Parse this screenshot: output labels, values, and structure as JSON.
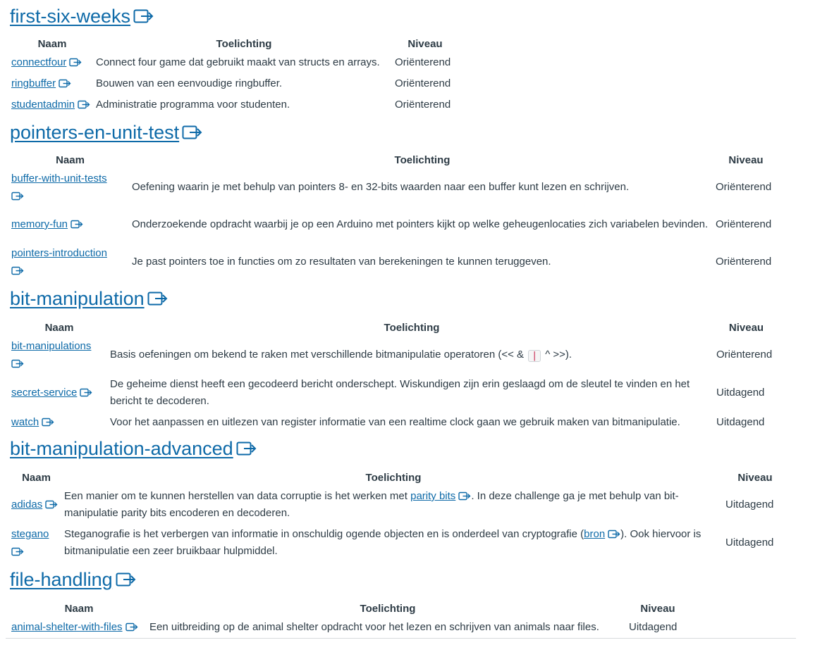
{
  "icons": {
    "external_link": "external-link-icon"
  },
  "colors": {
    "link": "#0e6aa8",
    "text": "#2d3b45",
    "code": "#c7254e"
  },
  "sections": [
    {
      "title": "first-six-weeks",
      "headers": {
        "name": "Naam",
        "desc": "Toelichting",
        "level": "Niveau"
      },
      "rows": [
        {
          "name": "connectfour",
          "desc": "Connect four game dat gebruikt maakt van structs en arrays.",
          "level": "Oriënterend"
        },
        {
          "name": "ringbuffer",
          "desc": "Bouwen van een eenvoudige ringbuffer.",
          "level": "Oriënterend"
        },
        {
          "name": "studentadmin",
          "desc": "Administratie programma voor studenten.",
          "level": "Oriënterend"
        }
      ]
    },
    {
      "title": "pointers-en-unit-test",
      "headers": {
        "name": "Naam",
        "desc": "Toelichting",
        "level": "Niveau"
      },
      "rows": [
        {
          "name": "buffer-with-unit-tests",
          "desc": "Oefening waarin je met behulp van pointers 8- en 32-bits waarden naar een buffer kunt lezen en schrijven.",
          "level": "Oriënterend"
        },
        {
          "name": "memory-fun",
          "desc": "Onderzoekende opdracht waarbij je op een Arduino met pointers kijkt op welke geheugenlocaties zich variabelen bevinden.",
          "level": "Oriënterend"
        },
        {
          "name": "pointers-introduction",
          "desc": "Je past pointers toe in functies om zo resultaten van berekeningen te kunnen teruggeven.",
          "level": "Oriënterend"
        }
      ]
    },
    {
      "title": "bit-manipulation",
      "headers": {
        "name": "Naam",
        "desc": "Toelichting",
        "level": "Niveau"
      },
      "rows": [
        {
          "name": "bit-manipulations",
          "desc_pre": "Basis oefeningen om bekend te raken met verschillende bitmanipulatie operatoren (<< &",
          "desc_code": "|",
          "desc_post": "^ >>).",
          "level": "Oriënterend"
        },
        {
          "name": "secret-service",
          "desc": "De geheime dienst heeft een gecodeerd bericht onderschept. Wiskundigen zijn erin geslaagd om de sleutel te vinden en het bericht te decoderen.",
          "level": "Uitdagend"
        },
        {
          "name": "watch",
          "desc": "Voor het aanpassen en uitlezen van register informatie van een realtime clock gaan we gebruik maken van bitmanipulatie.",
          "level": "Uitdagend"
        }
      ]
    },
    {
      "title": "bit-manipulation-advanced",
      "headers": {
        "name": "Naam",
        "desc": "Toelichting",
        "level": "Niveau"
      },
      "rows": [
        {
          "name": "adidas",
          "desc_pre": "Een manier om te kunnen herstellen van data corruptie is het werken met",
          "desc_link": "parity bits",
          "desc_post": ". In deze challenge ga je met behulp van bit-manipulatie parity bits encoderen en decoderen.",
          "level": "Uitdagend"
        },
        {
          "name": "stegano",
          "desc_pre": "Steganografie is het verbergen van informatie in onschuldig ogende objecten en is onderdeel van cryptografie (",
          "desc_link": "bron",
          "desc_post": "). Ook hiervoor is bitmanipulatie een zeer bruikbaar hulpmiddel.",
          "level": "Uitdagend"
        }
      ]
    },
    {
      "title": "file-handling",
      "headers": {
        "name": "Naam",
        "desc": "Toelichting",
        "level": "Niveau"
      },
      "rows": [
        {
          "name": "animal-shelter-with-files",
          "desc": "Een uitbreiding op de animal shelter opdracht voor het lezen en schrijven van animals naar files.",
          "level": "Uitdagend"
        }
      ]
    }
  ]
}
